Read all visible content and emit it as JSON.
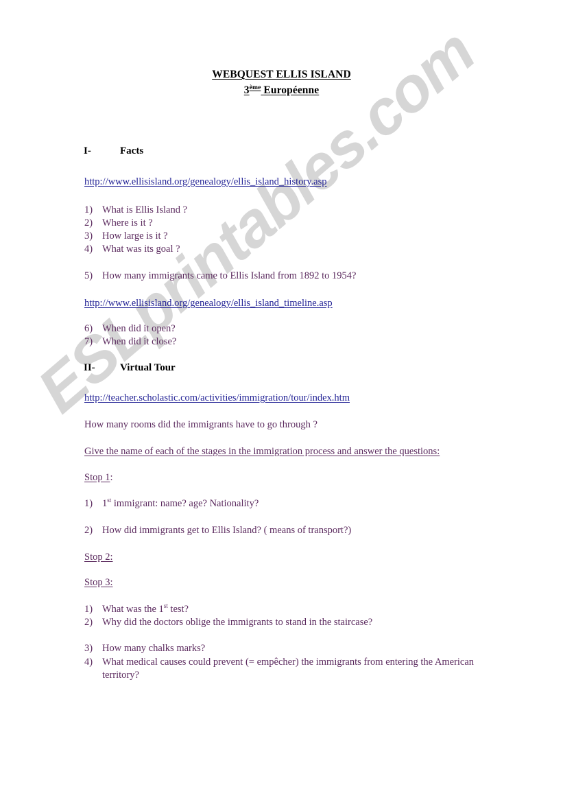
{
  "document": {
    "title_line1": "WEBQUEST ELLIS ISLAND",
    "title_line2_prefix": "3",
    "title_line2_sup": "ème",
    "title_line2_rest": "Européenne"
  },
  "watermark": {
    "text": "ESLprintables.com",
    "color": "#d6d6d6"
  },
  "colors": {
    "heading": "#000000",
    "link": "#242496",
    "body": "#5b2a5e"
  },
  "sections": [
    {
      "number": "I-",
      "title": "Facts"
    },
    {
      "number": "II-",
      "title": "Virtual Tour"
    }
  ],
  "links": {
    "history": "http://www.ellisisland.org/genealogy/ellis_island_history.asp",
    "timeline": "http://www.ellisisland.org/genealogy/ellis_island_timeline.asp",
    "virtual_tour": "http://teacher.scholastic.com/activities/immigration/tour/index.htm"
  },
  "facts_questions_a": [
    {
      "marker": "1)",
      "text": "What is Ellis Island ?"
    },
    {
      "marker": "2)",
      "text": "Where is it ?"
    },
    {
      "marker": "3)",
      "text": "How large is it ?"
    },
    {
      "marker": "4)",
      "text": "What was its goal ?"
    }
  ],
  "facts_question_5": {
    "marker": "5)",
    "text": "How many immigrants came to Ellis Island from 1892 to 1954?"
  },
  "facts_questions_b": [
    {
      "marker": "6)",
      "text": "When did it open?"
    },
    {
      "marker": "7)",
      "text": "When did it close?"
    }
  ],
  "virtual_tour": {
    "rooms_question": "How many rooms did the immigrants have to go through ?",
    "instruction": "Give the name of each of the stages in the immigration process and answer the questions:",
    "stop1_label": "Stop 1",
    "stop1_colon": ":",
    "stop2_label": "Stop 2:",
    "stop3_label": "Stop 3:",
    "stop1_questions": [
      {
        "marker": "1)",
        "prefix": "1",
        "sup": "st",
        "rest": " immigrant: name? age? Nationality?"
      },
      {
        "marker": "2)",
        "text": "How did immigrants get to Ellis Island? ( means of transport?)"
      }
    ],
    "stop3_questions": [
      {
        "marker": "1)",
        "prefix": "What was the 1",
        "sup": "st",
        "rest": " test?"
      },
      {
        "marker": "2)",
        "text": "Why did the doctors oblige the immigrants to stand in the staircase?"
      },
      {
        "marker": "3)",
        "text": "How many chalks marks?"
      },
      {
        "marker": "4)",
        "text": "What medical causes could prevent (= empêcher) the immigrants from entering the American territory?"
      }
    ]
  }
}
